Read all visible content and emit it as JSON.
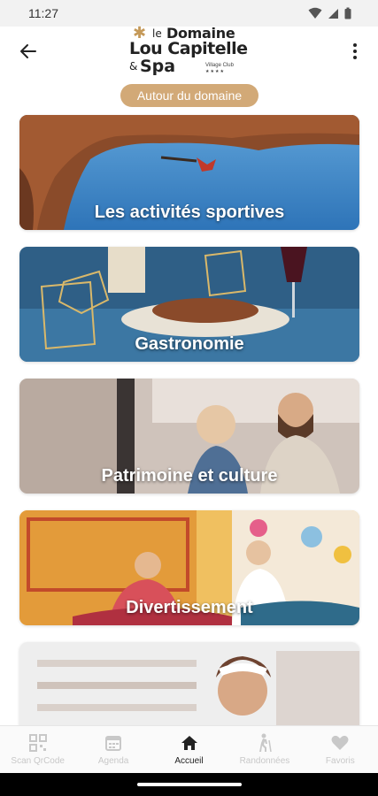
{
  "status_bar": {
    "time": "11:27"
  },
  "header": {
    "logo": {
      "le": "le",
      "domaine": "Domaine",
      "lou_capitelle": "Lou Capitelle",
      "amp": "&",
      "spa": "Spa",
      "village_club": "Village Club",
      "stars": "★★★★"
    }
  },
  "section_pill": "Autour du domaine",
  "cards": [
    {
      "label": "Les activités sportives"
    },
    {
      "label": "Gastronomie"
    },
    {
      "label": "Patrimoine et culture"
    },
    {
      "label": "Divertissement"
    },
    {
      "label": ""
    }
  ],
  "bottom_nav": {
    "items": [
      {
        "label": "Scan QrCode",
        "icon": "qr-code-icon"
      },
      {
        "label": "Agenda",
        "icon": "calendar-icon"
      },
      {
        "label": "Accueil",
        "icon": "home-icon",
        "active": true
      },
      {
        "label": "Randonnées",
        "icon": "hiker-icon"
      },
      {
        "label": "Favoris",
        "icon": "heart-icon"
      }
    ]
  },
  "colors": {
    "accent": "#d2a977",
    "nav_inactive": "#c8c8c8",
    "nav_active": "#222222"
  }
}
